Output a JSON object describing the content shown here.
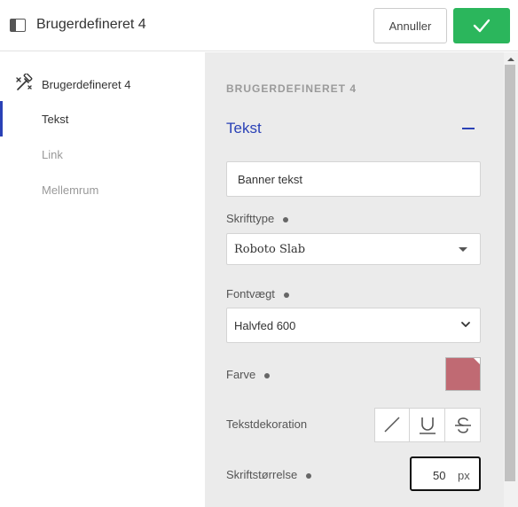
{
  "header": {
    "title": "Brugerdefineret 4",
    "cancel_label": "Annuller",
    "icon": "panel-icon",
    "confirm_icon": "check-icon"
  },
  "sidebar": {
    "head_label": "Brugerdefineret 4",
    "head_icon": "wand-icon",
    "items": [
      {
        "label": "Tekst",
        "active": true
      },
      {
        "label": "Link",
        "active": false
      },
      {
        "label": "Mellemrum",
        "active": false
      }
    ]
  },
  "main": {
    "section_title": "BRUGERDEFINERET 4",
    "group_title": "Tekst",
    "text_value": "Banner tekst",
    "font_label": "Skrifttype",
    "font_value": "Roboto Slab",
    "weight_label": "Fontvægt",
    "weight_value": "Halvfed 600",
    "color_label": "Farve",
    "color_value": "#c06a73",
    "decoration_label": "Tekstdekoration",
    "decoration_options": [
      "none-icon",
      "underline-icon",
      "strikethrough-icon"
    ],
    "size_label": "Skriftstørrelse",
    "size_value": "50",
    "size_unit": "px"
  },
  "colors": {
    "accent": "#2a41b6",
    "confirm": "#2bb65c",
    "panel_bg": "#ebebeb"
  }
}
